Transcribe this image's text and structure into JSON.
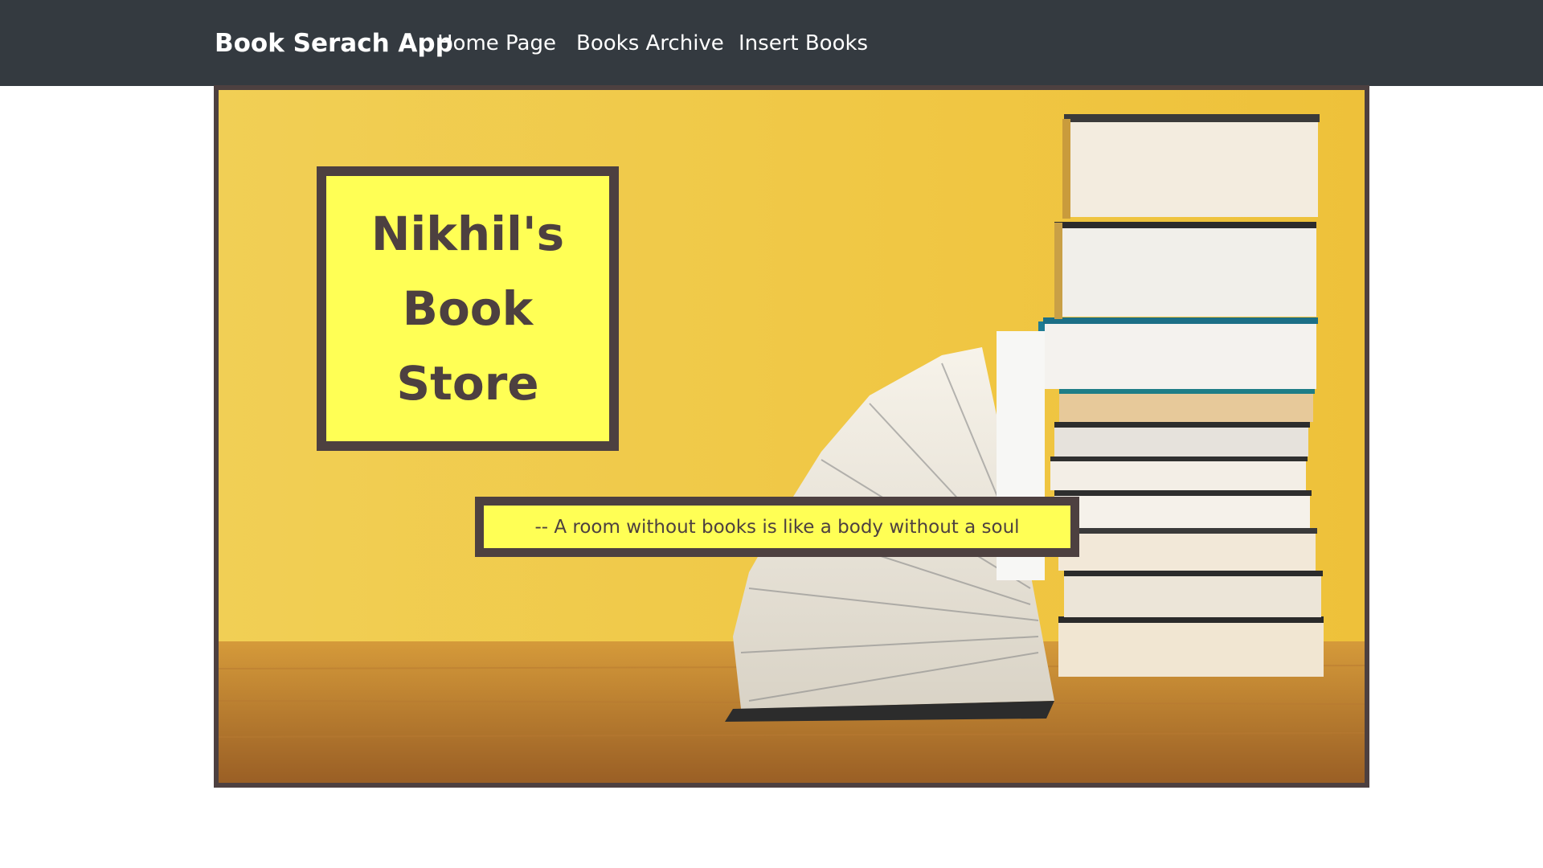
{
  "navbar": {
    "brand": "Book Serach App",
    "links": [
      {
        "label": "Home Page"
      },
      {
        "label": "Books Archive"
      },
      {
        "label": "Insert Books"
      }
    ],
    "background": "#343a40"
  },
  "hero": {
    "image": "stack-of-books-photo",
    "title": "Nikhil's Book Store",
    "quote": "-- A room without books is like a body without a soul",
    "colors": {
      "wall": "#f0c840",
      "box_fill": "#ffff55",
      "box_border": "#4d4040"
    }
  }
}
